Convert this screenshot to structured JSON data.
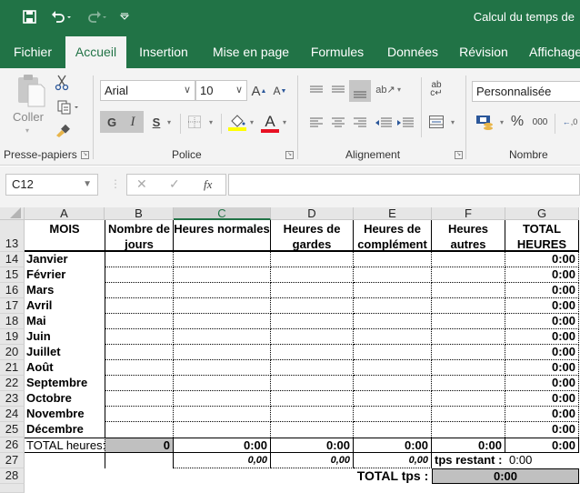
{
  "title_bar": {
    "title": "Calcul du temps de",
    "quick_access": {
      "save": "save-icon",
      "undo": "undo-icon",
      "redo": "redo-icon",
      "customize": "customize-qat-icon"
    }
  },
  "tabs": [
    {
      "label": "Fichier",
      "active": false
    },
    {
      "label": "Accueil",
      "active": true
    },
    {
      "label": "Insertion",
      "active": false
    },
    {
      "label": "Mise en page",
      "active": false
    },
    {
      "label": "Formules",
      "active": false
    },
    {
      "label": "Données",
      "active": false
    },
    {
      "label": "Révision",
      "active": false
    },
    {
      "label": "Affichage",
      "active": false
    }
  ],
  "ribbon": {
    "clipboard": {
      "label": "Presse-papiers",
      "paste_label": "Coller"
    },
    "font": {
      "label": "Police",
      "font_name": "Arial",
      "font_size": "10",
      "bold": "G",
      "italic": "I",
      "underline": "S",
      "grow": "A",
      "shrink": "A",
      "color_letter": "A",
      "highlight_color": "#ffff00",
      "font_color": "#e81123"
    },
    "alignment": {
      "label": "Alignement",
      "wrap": "ab c"
    },
    "number": {
      "label": "Nombre",
      "format": "Personnalisée",
      "percent": "%",
      "thousands": "000",
      "decimal": "←,0 ,00"
    }
  },
  "formula_bar": {
    "name_box": "C12",
    "cancel": "✕",
    "enter": "✓",
    "fx": "fx",
    "formula": ""
  },
  "sheet": {
    "columns": [
      "A",
      "B",
      "C",
      "D",
      "E",
      "F",
      "G"
    ],
    "selected_column": "C",
    "header_row": {
      "row": "13",
      "cells": [
        "MOIS",
        "Nombre de jours",
        "Heures normales",
        "Heures de gardes",
        "Heures de complément",
        "Heures autres",
        "TOTAL HEURES"
      ]
    },
    "months": [
      {
        "row": "14",
        "name": "Janvier",
        "total": "0:00"
      },
      {
        "row": "15",
        "name": "Février",
        "total": "0:00"
      },
      {
        "row": "16",
        "name": "Mars",
        "total": "0:00"
      },
      {
        "row": "17",
        "name": "Avril",
        "total": "0:00"
      },
      {
        "row": "18",
        "name": "Mai",
        "total": "0:00"
      },
      {
        "row": "19",
        "name": "Juin",
        "total": "0:00"
      },
      {
        "row": "20",
        "name": "Juillet",
        "total": "0:00"
      },
      {
        "row": "21",
        "name": "Août",
        "total": "0:00"
      },
      {
        "row": "22",
        "name": "Septembre",
        "total": "0:00"
      },
      {
        "row": "23",
        "name": "Octobre",
        "total": "0:00"
      },
      {
        "row": "24",
        "name": "Novembre",
        "total": "0:00"
      },
      {
        "row": "25",
        "name": "Décembre",
        "total": "0:00"
      }
    ],
    "total_row": {
      "row": "26",
      "label": "TOTAL heures:",
      "days": "0",
      "normales": "0:00",
      "gardes": "0:00",
      "complement": "0:00",
      "autres": "0:00",
      "total": "0:00"
    },
    "decimal_row": {
      "row": "27",
      "normales": "0,00",
      "gardes": "0,00",
      "complement": "0,00",
      "remaining_label": "tps restant :",
      "remaining_value": "0:00"
    },
    "grand_total_row": {
      "row": "28",
      "label": "TOTAL tps :",
      "value": "0:00"
    }
  }
}
